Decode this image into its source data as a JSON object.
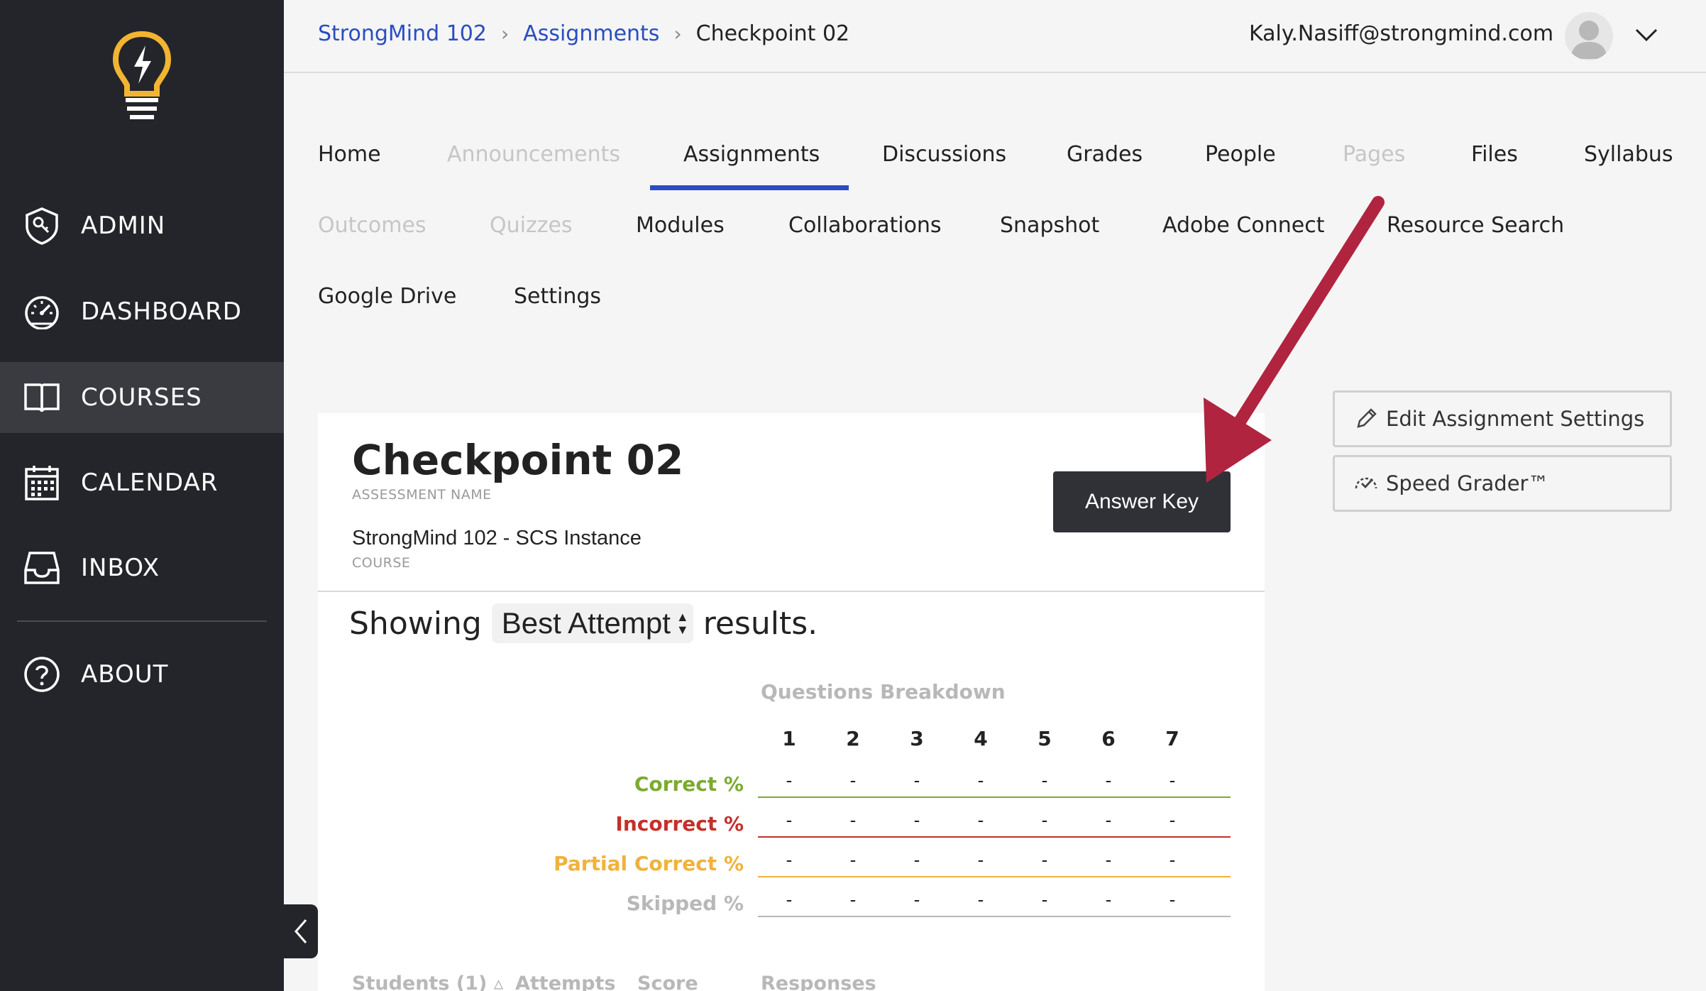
{
  "sidebar": {
    "items": [
      {
        "label": "ADMIN",
        "icon": "admin-shield-icon"
      },
      {
        "label": "DASHBOARD",
        "icon": "speedometer-icon"
      },
      {
        "label": "COURSES",
        "icon": "book-icon"
      },
      {
        "label": "CALENDAR",
        "icon": "calendar-icon"
      },
      {
        "label": "INBOX",
        "icon": "inbox-icon"
      },
      {
        "label": "ABOUT",
        "icon": "help-circle-icon"
      }
    ],
    "active": "COURSES"
  },
  "breadcrumb": {
    "items": [
      "StrongMind 102",
      "Assignments",
      "Checkpoint 02"
    ]
  },
  "user": {
    "email": "Kaly.Nasiff@strongmind.com"
  },
  "course_nav": {
    "items": [
      "Home",
      "Announcements",
      "Assignments",
      "Discussions",
      "Grades",
      "People",
      "Pages",
      "Files",
      "Syllabus",
      "Outcomes",
      "Quizzes",
      "Modules",
      "Collaborations",
      "Snapshot",
      "Adobe Connect",
      "Resource Search",
      "Google Drive",
      "Settings"
    ]
  },
  "actions": {
    "edit_settings": "Edit Assignment Settings",
    "speed_grader": "Speed Grader™"
  },
  "assignment": {
    "title": "Checkpoint 02",
    "title_caption": "ASSESSMENT NAME",
    "course": "StrongMind 102 - SCS Instance",
    "course_caption": "COURSE",
    "answer_key": "Answer Key"
  },
  "results": {
    "showing_prefix": "Showing",
    "selected_attempt": "Best Attempt",
    "showing_suffix": "results."
  },
  "breakdown": {
    "title": "Questions Breakdown",
    "questions": [
      "1",
      "2",
      "3",
      "4",
      "5",
      "6",
      "7"
    ],
    "rows": [
      {
        "label": "Correct %",
        "color": "#7bab2f",
        "values": [
          "-",
          "-",
          "-",
          "-",
          "-",
          "-",
          "-"
        ]
      },
      {
        "label": "Incorrect %",
        "color": "#c4302b",
        "values": [
          "-",
          "-",
          "-",
          "-",
          "-",
          "-",
          "-"
        ]
      },
      {
        "label": "Partial Correct %",
        "color": "#f0b23b",
        "values": [
          "-",
          "-",
          "-",
          "-",
          "-",
          "-",
          "-"
        ]
      },
      {
        "label": "Skipped %",
        "color": "#b8b8b8",
        "values": [
          "-",
          "-",
          "-",
          "-",
          "-",
          "-",
          "-"
        ]
      }
    ]
  },
  "students_table": {
    "headers": [
      "Students (1)",
      "Attempts",
      "Score",
      "Responses"
    ]
  },
  "colors": {
    "sidebar_bg": "#24252a",
    "accent_blue": "#2a4dc0",
    "logo_yellow": "#f2b531",
    "annotation_arrow": "#b0243f"
  }
}
